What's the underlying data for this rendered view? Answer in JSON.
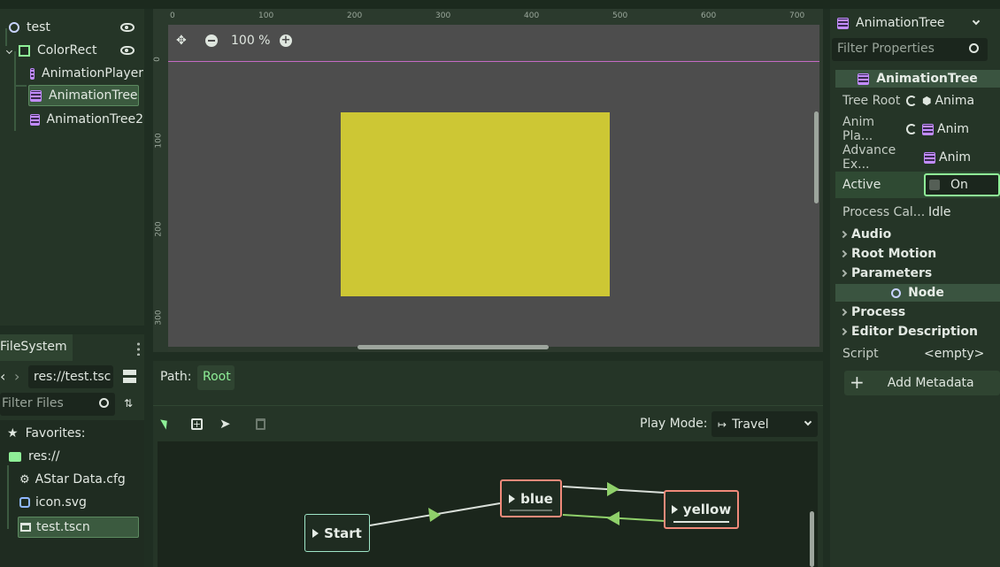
{
  "scene_tree": {
    "nodes": [
      {
        "label": "test"
      },
      {
        "label": "ColorRect"
      },
      {
        "label": "AnimationPlayer"
      },
      {
        "label": "AnimationTree"
      },
      {
        "label": "AnimationTree2"
      }
    ]
  },
  "filesystem": {
    "tab_label": "FileSystem",
    "path_value": "res://test.tsc",
    "filter_placeholder": "Filter Files",
    "favorites_label": "Favorites:",
    "root_label": "res://",
    "files": [
      {
        "label": "AStar Data.cfg"
      },
      {
        "label": "icon.svg"
      },
      {
        "label": "test.tscn"
      }
    ]
  },
  "viewport": {
    "zoom_label": "100 %",
    "ruler_h": [
      "0",
      "100",
      "200",
      "300",
      "400",
      "500",
      "600",
      "700"
    ],
    "ruler_v": [
      "0",
      "100",
      "200",
      "300"
    ],
    "rect_color": "#cdc734",
    "canvas_color": "#4d4d4d"
  },
  "animation_tree": {
    "path_label": "Path:",
    "path_root": "Root",
    "play_mode_label": "Play Mode:",
    "play_mode_value": "Travel",
    "states": [
      {
        "name": "Start"
      },
      {
        "name": "blue"
      },
      {
        "name": "yellow"
      }
    ]
  },
  "inspector": {
    "node_selector": "AnimationTree",
    "filter_placeholder": "Filter Properties",
    "class_header": "AnimationTree",
    "properties": [
      {
        "label": "Tree Root",
        "value": "Anima"
      },
      {
        "label": "Anim Pla...",
        "value": "Anim"
      },
      {
        "label": "Advance Ex...",
        "value": "Anim"
      },
      {
        "label": "Active",
        "value": "On"
      },
      {
        "label": "Process Cal...",
        "value": "Idle"
      }
    ],
    "sections": [
      "Audio",
      "Root Motion",
      "Parameters"
    ],
    "node_header": "Node",
    "node_sections": [
      "Process",
      "Editor Description"
    ],
    "script_label": "Script",
    "script_value": "<empty>",
    "add_metadata": "Add Metadata"
  },
  "colors": {
    "accent_green": "#8eef97",
    "node_border_red": "#f08a7a",
    "node_border_mint": "#9fe6c8",
    "transition_arrow": "#8fd06a"
  }
}
